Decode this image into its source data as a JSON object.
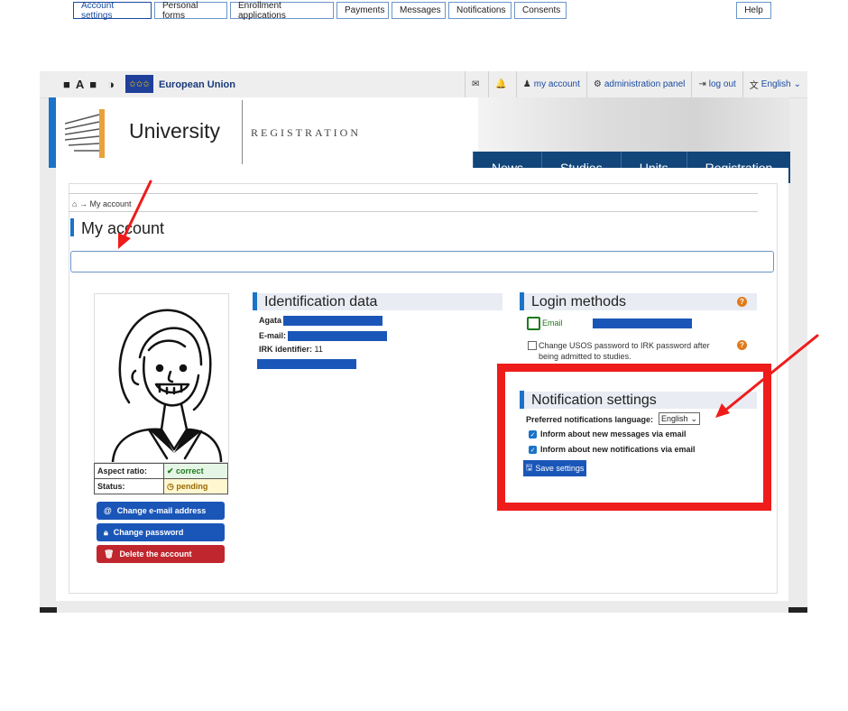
{
  "topbar": {
    "eu_label": "European Union",
    "items": [
      {
        "label": "",
        "icon": "envelope-icon"
      },
      {
        "label": "",
        "icon": "bell-icon"
      },
      {
        "label": "my account",
        "icon": "user-icon"
      },
      {
        "label": "administration panel",
        "icon": "gear-icon"
      },
      {
        "label": "log out",
        "icon": "logout-icon"
      },
      {
        "label": "English",
        "icon": "language-icon"
      }
    ]
  },
  "header": {
    "university": "University",
    "subtitle": "REGISTRATION"
  },
  "nav": [
    "News",
    "Studies",
    "Units",
    "Registration"
  ],
  "breadcrumb": "My account",
  "page_title": "My account",
  "tabs": [
    "Account settings",
    "Personal forms",
    "Enrollment applications",
    "Payments",
    "Messages",
    "Notifications",
    "Consents"
  ],
  "help_tab": "Help",
  "status": {
    "aspect_label": "Aspect ratio:",
    "aspect_value": "correct",
    "status_label": "Status:",
    "status_value": "pending"
  },
  "actions": {
    "change_email": "Change e-mail address",
    "change_password": "Change password",
    "delete_account": "Delete the account"
  },
  "identification": {
    "title": "Identification data",
    "first_name": "Agata",
    "email_label": "E-mail:",
    "irk_label": "IRK identifier:",
    "irk_value": "11"
  },
  "login": {
    "title": "Login methods",
    "email_method": "Email",
    "change_pw_text_line1": "Change USOS password to IRK password after",
    "change_pw_text_line2": "being admitted to studies."
  },
  "notifications": {
    "title": "Notification settings",
    "language_label": "Preferred notifications language:",
    "language_value": "English",
    "opt_messages": "Inform about new messages via email",
    "opt_notifications": "Inform about new notifications via email",
    "save_label": "Save settings"
  },
  "colors": {
    "accent": "#1a73c8",
    "nav_bg": "#12457a",
    "highlight": "#ef1c1c",
    "danger": "#c0262d"
  }
}
